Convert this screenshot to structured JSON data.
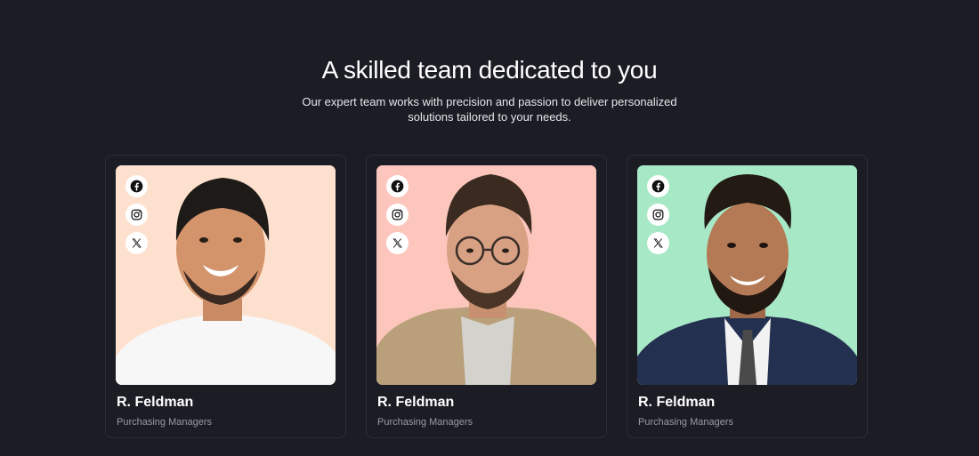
{
  "header": {
    "title": "A skilled team dedicated to you",
    "subtitle": "Our expert team works with precision and passion to deliver personalized solutions tailored to your needs."
  },
  "team": [
    {
      "name": "R. Feldman",
      "role": "Purchasing Managers",
      "photo_bg": "#fde0cd",
      "photo_alt": "Smiling young man in white t-shirt"
    },
    {
      "name": "R. Feldman",
      "role": "Purchasing Managers",
      "photo_bg": "#fcc6bd",
      "photo_alt": "Man with glasses and beard in khaki shirt"
    },
    {
      "name": "R. Feldman",
      "role": "Purchasing Managers",
      "photo_bg": "#a7e8c6",
      "photo_alt": "Smiling bearded man in navy suit and tie"
    }
  ],
  "social_icons": [
    "facebook-icon",
    "instagram-icon",
    "x-icon"
  ],
  "colors": {
    "background": "#1b1c24",
    "card_border": "#2c2d36",
    "title": "#ffffff",
    "role": "#9a9ba5"
  }
}
